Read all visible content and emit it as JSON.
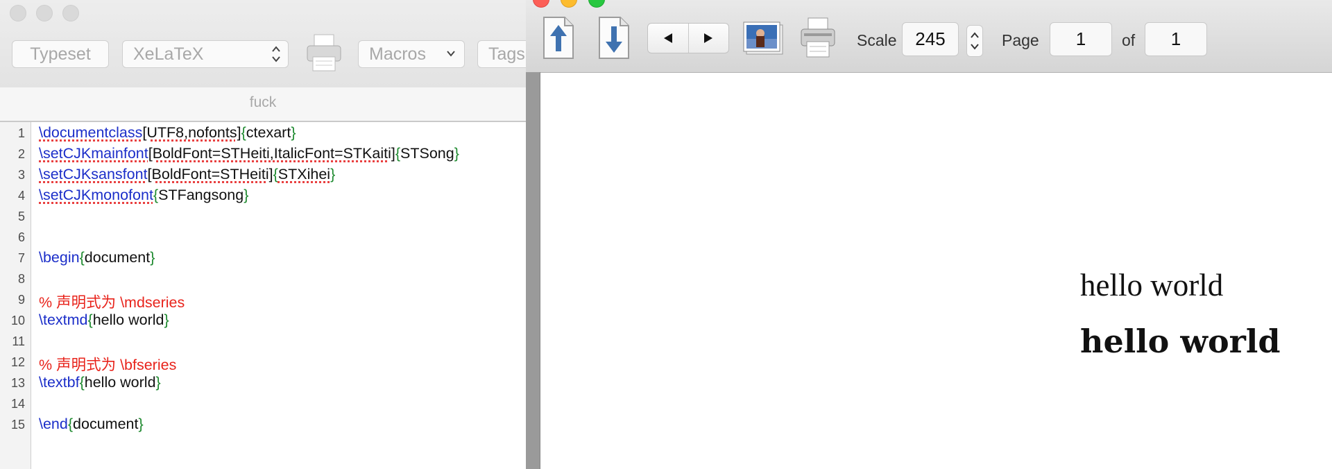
{
  "editor": {
    "toolbar": {
      "typeset_label": "Typeset",
      "engine_selected": "XeLaTeX",
      "macros_label": "Macros",
      "tags_label": "Tags"
    },
    "document_name": "fuck",
    "lines": [
      {
        "n": "1"
      },
      {
        "n": "2"
      },
      {
        "n": "3"
      },
      {
        "n": "4"
      },
      {
        "n": "5"
      },
      {
        "n": "6"
      },
      {
        "n": "7"
      },
      {
        "n": "8"
      },
      {
        "n": "9"
      },
      {
        "n": "10"
      },
      {
        "n": "11"
      },
      {
        "n": "12"
      },
      {
        "n": "13"
      },
      {
        "n": "14"
      },
      {
        "n": "15"
      }
    ],
    "code": {
      "l1": {
        "cmd": "\\documentclass",
        "opt": "[UTF8,nofonts]",
        "ob": "{",
        "arg": "ctexart",
        "cb": "}"
      },
      "l2": {
        "cmd": "\\setCJKmainfont",
        "opt": "[BoldFont=STHeiti,ItalicFont=STKaiti]",
        "ob": "{",
        "arg": "STSong",
        "cb": "}"
      },
      "l3": {
        "cmd": "\\setCJKsansfont",
        "opt": "[BoldFont=STHeiti]",
        "ob": "{",
        "arg": "STXihei",
        "cb": "}"
      },
      "l4": {
        "cmd": "\\setCJKmonofont",
        "ob": "{",
        "arg": "STFangsong",
        "cb": "}"
      },
      "l7": {
        "cmd": "\\begin",
        "ob": "{",
        "arg": "document",
        "cb": "}"
      },
      "l9": {
        "comment": "% 声明式为 \\mdseries"
      },
      "l10": {
        "cmd": "\\textmd",
        "ob": "{",
        "arg": "hello world",
        "cb": "}"
      },
      "l12": {
        "comment": "% 声明式为 \\bfseries"
      },
      "l13": {
        "cmd": "\\textbf",
        "ob": "{",
        "arg": "hello world",
        "cb": "}"
      },
      "l15": {
        "cmd": "\\end",
        "ob": "{",
        "arg": "document",
        "cb": "}"
      }
    }
  },
  "preview": {
    "scale_label": "Scale",
    "scale_value": "245",
    "page_label": "Page",
    "page_value": "1",
    "of_label": "of",
    "page_total": "1",
    "content": {
      "md_text": "hello world",
      "bf_text": "hello world"
    }
  },
  "colors": {
    "command": "#1b2ec9",
    "brace": "#1e8a2f",
    "comment": "#e8231b",
    "arrow_blue": "#3f72b0"
  }
}
